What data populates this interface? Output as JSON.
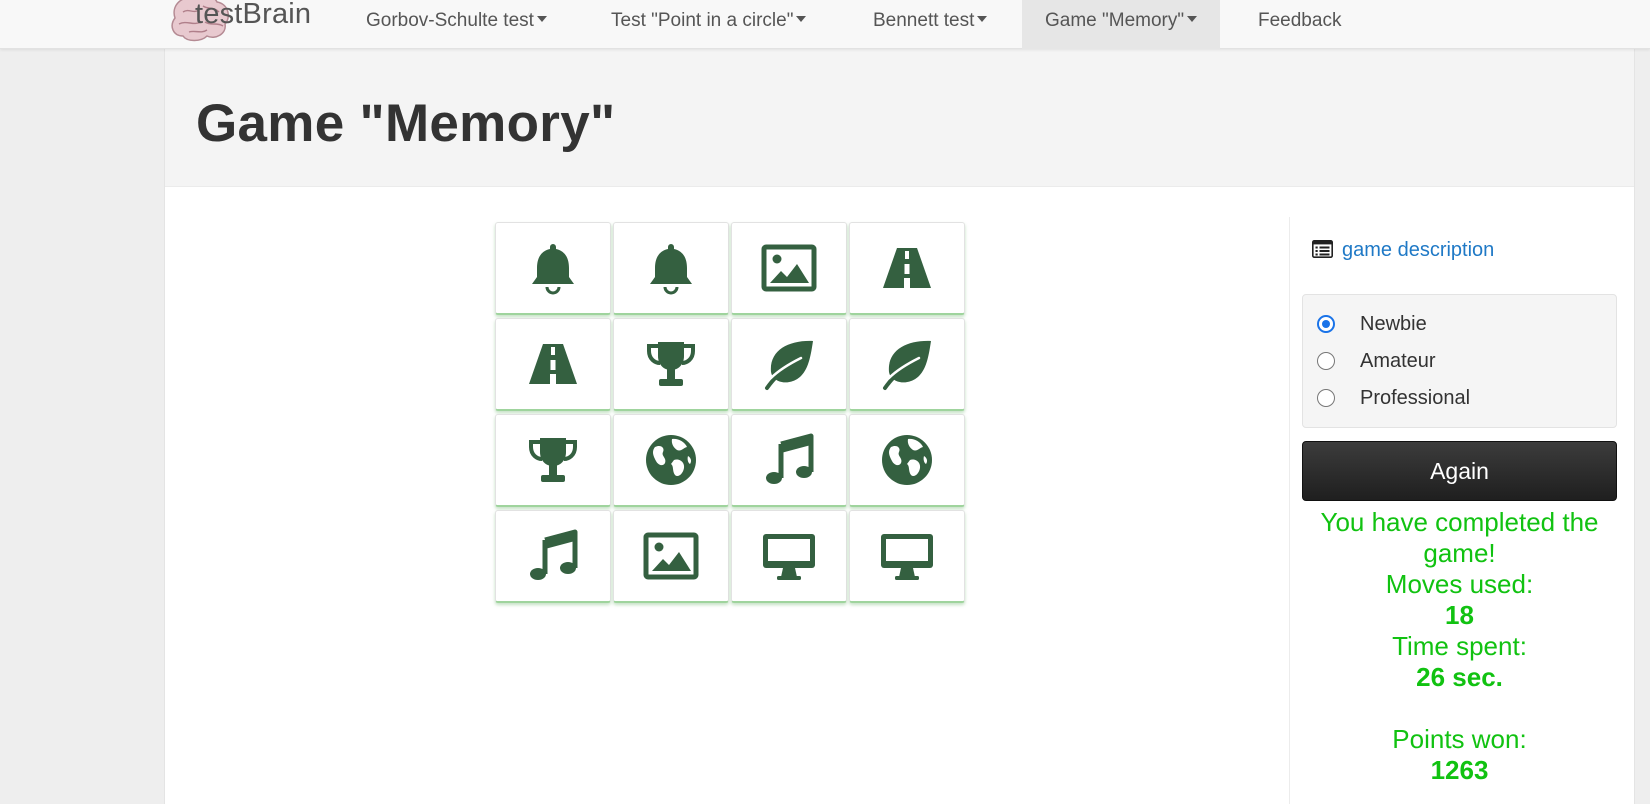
{
  "brand": {
    "name": "testBrain"
  },
  "nav": {
    "items": [
      {
        "label": "Gorbov-Schulte test",
        "dropdown": true,
        "active": false
      },
      {
        "label": "Test \"Point in a circle\"",
        "dropdown": true,
        "active": false
      },
      {
        "label": "Bennett test",
        "dropdown": true,
        "active": false
      },
      {
        "label": "Game \"Memory\"",
        "dropdown": true,
        "active": true
      },
      {
        "label": "Feedback",
        "dropdown": false,
        "active": false
      }
    ]
  },
  "page": {
    "title": "Game \"Memory\""
  },
  "game": {
    "icon_color": "#346040",
    "cards": [
      "bell-icon",
      "bell-icon",
      "image-icon",
      "road-icon",
      "road-icon",
      "trophy-icon",
      "leaf-icon",
      "leaf-icon",
      "trophy-icon",
      "globe-icon",
      "music-icon",
      "globe-icon",
      "music-icon",
      "image-icon",
      "desktop-icon",
      "desktop-icon"
    ]
  },
  "sidebar": {
    "description_link": "game description",
    "levels": [
      {
        "label": "Newbie",
        "checked": true
      },
      {
        "label": "Amateur",
        "checked": false
      },
      {
        "label": "Professional",
        "checked": false
      }
    ],
    "again_label": "Again",
    "result": {
      "completed": "You have completed the game!",
      "moves_label": "Moves used:",
      "moves_value": "18",
      "time_label": "Time spent:",
      "time_value": "26 sec.",
      "points_label": "Points won:",
      "points_value": "1263",
      "color": "#11c211"
    }
  }
}
